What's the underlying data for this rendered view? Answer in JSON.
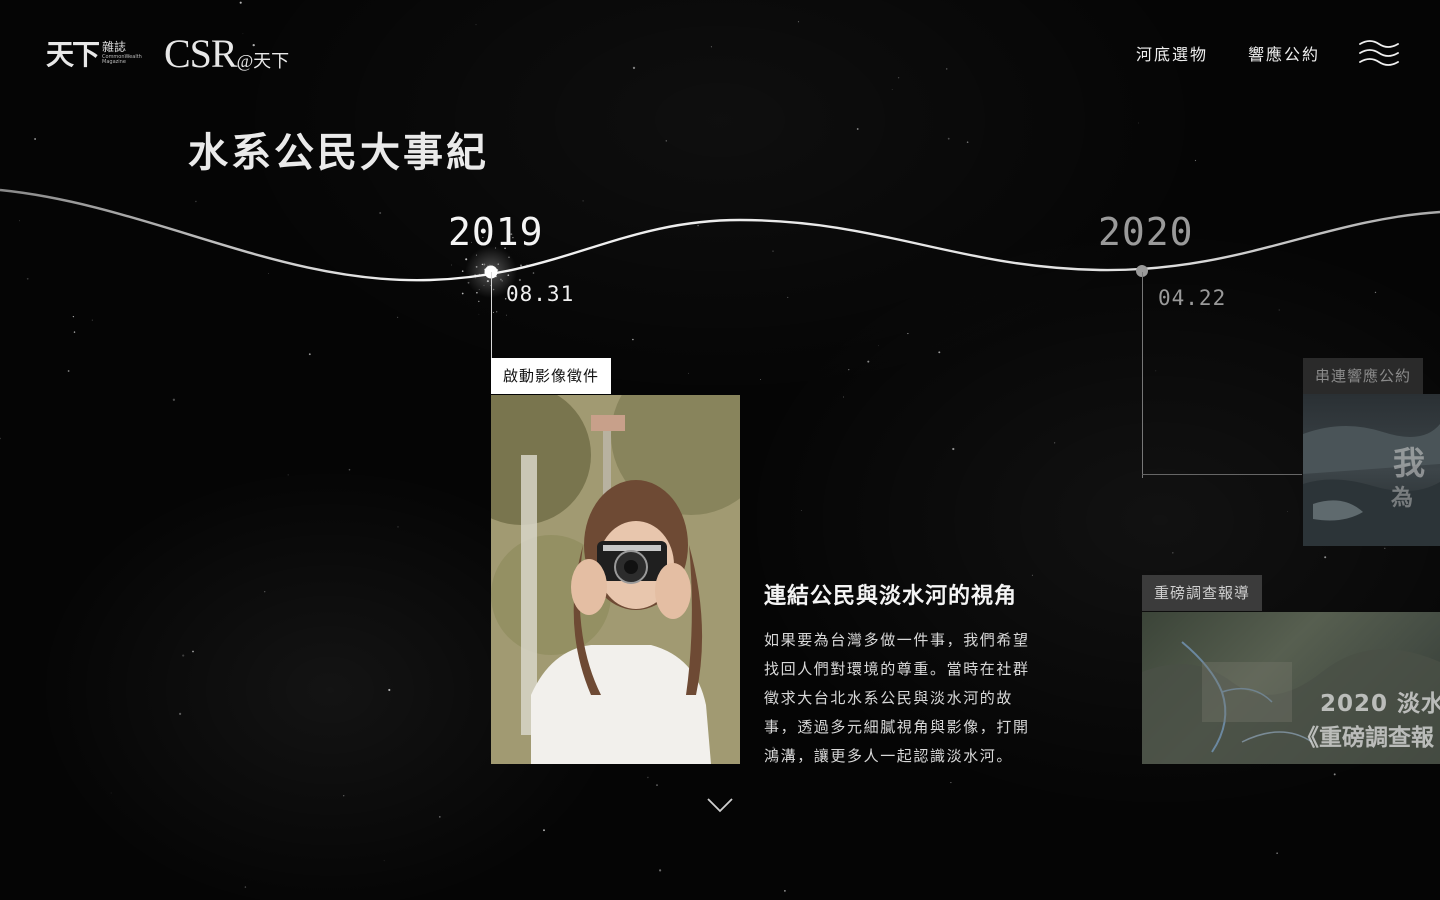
{
  "header": {
    "logo_cw_main": "天下",
    "logo_cw_zh": "雜誌",
    "logo_cw_en1": "CommonWealth",
    "logo_cw_en2": "Magazine",
    "logo_csr_main": "CSR",
    "logo_csr_suffix": "@天下",
    "nav": [
      "河底選物",
      "響應公約"
    ]
  },
  "page_title": "水系公民大事紀",
  "timeline": {
    "years": [
      "2019",
      "2020"
    ],
    "events": [
      {
        "date": "08.31",
        "tag": "啟動影像徵件",
        "title": "連結公民與淡水河的視角",
        "body": "如果要為台灣多做一件事，我們希望找回人們對環境的尊重。當時在社群徵求大台北水系公民與淡水河的故事，透過多元細膩視角與影像，打開鴻溝，讓更多人一起認識淡水河。"
      },
      {
        "date": "04.22",
        "tag": "串連響應公約",
        "image_text": [
          "我",
          "為"
        ]
      },
      {
        "tag": "重磅調查報導",
        "image_text": [
          "2020 淡水",
          "《重磅調查報"
        ]
      }
    ]
  },
  "colors": {
    "background": "#050505",
    "active": "#ffffff",
    "inactive": "#9a9a9a"
  },
  "icons": {
    "menu": "wave-menu-icon",
    "scroll": "chevron-down-icon"
  }
}
